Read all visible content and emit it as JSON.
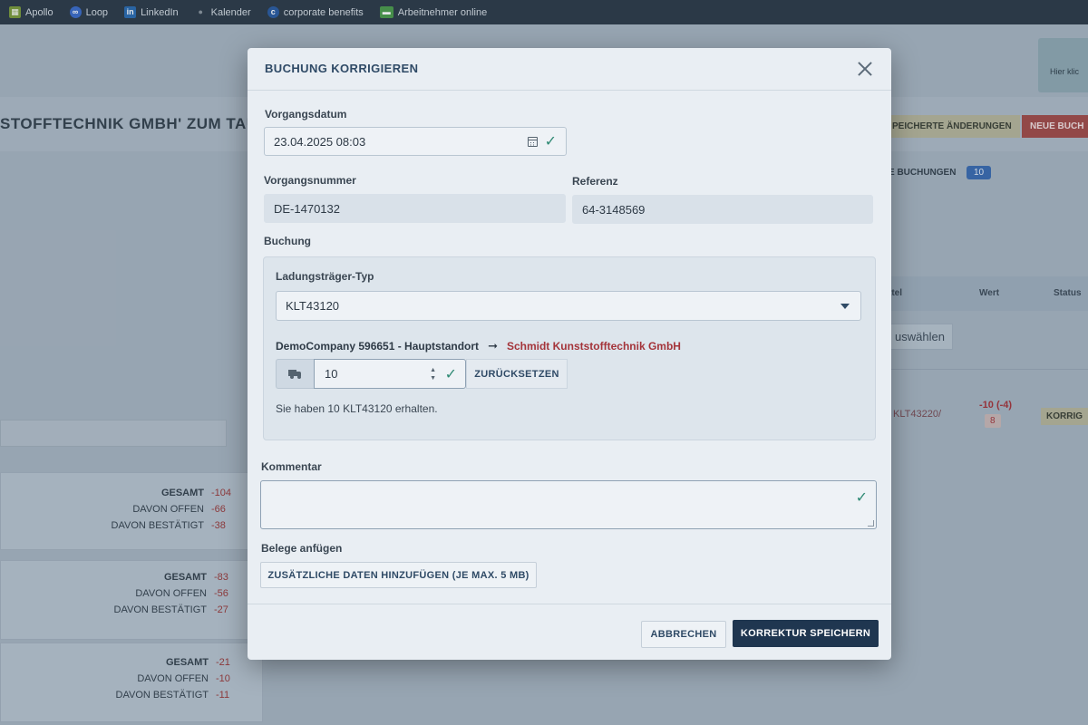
{
  "bookmarks": [
    {
      "label": "Apollo",
      "icon": "apollo-icon",
      "color": "#7a9a3a"
    },
    {
      "label": "Loop",
      "icon": "loop-icon",
      "color": "#3a6ac8"
    },
    {
      "label": "LinkedIn",
      "icon": "linkedin-icon",
      "color": "#2a6ab0"
    },
    {
      "label": "Kalender",
      "icon": "apple-icon",
      "color": "#8a949e"
    },
    {
      "label": "corporate benefits",
      "icon": "corporate-benefits-icon",
      "color": "#2a5aa0"
    },
    {
      "label": "Arbeitnehmer online",
      "icon": "arbeitnehmer-online-icon",
      "color": "#4a9a4a"
    }
  ],
  "background": {
    "page_title": "STOFFTECHNIK GMBH' ZUM TAUSC",
    "hint_label": "Hier klic",
    "saved_changes_button": "PEICHERTE ÄNDERUNGEN",
    "new_booking_button": "NEUE BUCH",
    "bookings_tab": "E BUCHUNGEN",
    "bookings_count": "10",
    "col_mittel": "ttel",
    "col_wert": "Wert",
    "col_status": "Status",
    "select_placeholder": "uswählen",
    "row_item": "KLT43220/",
    "row_value": "-10 (-4)",
    "row_badge": "8",
    "row_action": "KORRIG",
    "cards": [
      {
        "gesamt_label": "GESAMT",
        "gesamt": "-104",
        "offen_label": "DAVON OFFEN",
        "offen": "-66",
        "bestaetigt_label": "DAVON BESTÄTIGT",
        "bestaetigt": "-38"
      },
      {
        "gesamt_label": "GESAMT",
        "gesamt": "-83",
        "offen_label": "DAVON OFFEN",
        "offen": "-56",
        "bestaetigt_label": "DAVON BESTÄTIGT",
        "bestaetigt": "-27"
      },
      {
        "gesamt_label": "GESAMT",
        "gesamt": "-21",
        "offen_label": "DAVON OFFEN",
        "offen": "-10",
        "bestaetigt_label": "DAVON BESTÄTIGT",
        "bestaetigt": "-11"
      }
    ]
  },
  "modal": {
    "title": "BUCHUNG KORRIGIEREN",
    "vorgangsdatum_label": "Vorgangsdatum",
    "vorgangsdatum_value": "23.04.2025 08:03",
    "vorgangsnummer_label": "Vorgangsnummer",
    "vorgangsnummer_value": "DE-1470132",
    "referenz_label": "Referenz",
    "referenz_value": "64-3148569",
    "buchung_label": "Buchung",
    "ladungstraeger_label": "Ladungsträger-Typ",
    "ladungstraeger_value": "KLT43120",
    "route_from": "DemoCompany 596651 - Hauptstandort",
    "route_to": "Schmidt Kunststofftechnik GmbH",
    "quantity": "10",
    "reset_button": "ZURÜCKSETZEN",
    "received_text": "Sie haben 10 KLT43120 erhalten.",
    "kommentar_label": "Kommentar",
    "kommentar_value": "",
    "belege_label": "Belege anfügen",
    "add_data_button": "ZUSÄTZLICHE DATEN HINZUFÜGEN (JE MAX. 5 MB)",
    "cancel_button": "ABBRECHEN",
    "save_button": "KORREKTUR SPEICHERN"
  }
}
